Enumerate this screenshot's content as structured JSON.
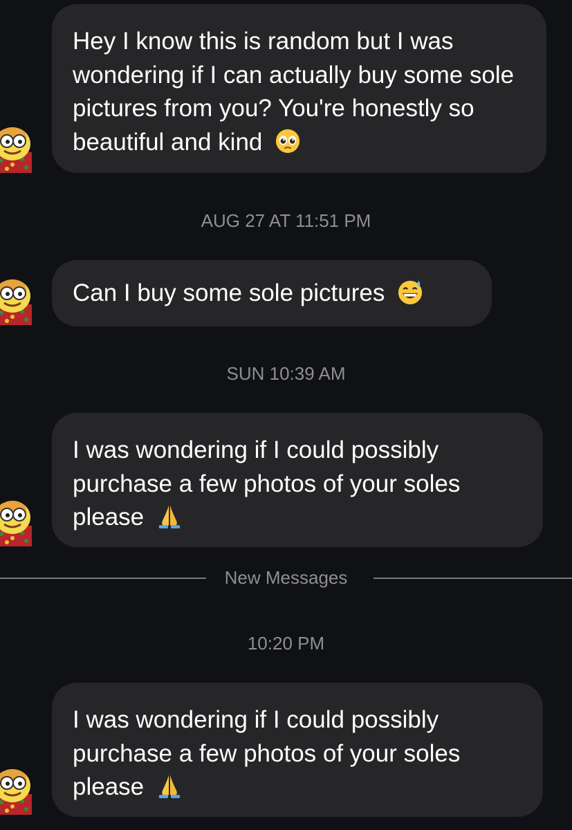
{
  "messages": [
    {
      "text": "Hey I know this is random but I was wondering if I can actually buy some sole pictures from you? You're honestly so beautiful and kind",
      "emoji": "pleading-face"
    },
    {
      "text": "Can I buy some sole pictures",
      "emoji": "grinning-face-with-sweat"
    },
    {
      "text": "I was wondering if I could possibly purchase a few photos of your soles please",
      "emoji": "folded-hands"
    },
    {
      "text": "I was wondering if I could possibly purchase a few photos of your soles please",
      "emoji": "folded-hands"
    }
  ],
  "timestamps": [
    "AUG 27 AT 11:51 PM",
    "SUN 10:39 AM",
    "10:20 PM"
  ],
  "divider": {
    "label": "New Messages"
  },
  "colors": {
    "background": "#0f1115",
    "bubble": "#262628",
    "text": "#ffffff",
    "meta": "#8e8e93"
  }
}
